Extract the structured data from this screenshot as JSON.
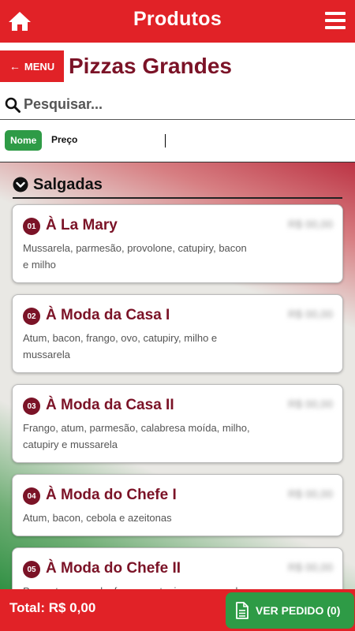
{
  "topbar": {
    "title": "Produtos"
  },
  "header": {
    "menu_label": "MENU",
    "page_title": "Pizzas Grandes"
  },
  "search": {
    "placeholder": "Pesquisar..."
  },
  "sort": {
    "nome": "Nome",
    "preco": "Preço"
  },
  "section": {
    "title": "Salgadas"
  },
  "products": [
    {
      "number": "01",
      "name": "À La Mary",
      "price": "R$ 00,00",
      "desc": "Mussarela, parmesão, provolone, catupiry, bacon e milho"
    },
    {
      "number": "02",
      "name": "À Moda da Casa I",
      "price": "R$ 00,00",
      "desc": "Atum, bacon, frango, ovo, catupiry, milho e mussarela"
    },
    {
      "number": "03",
      "name": "À Moda da Casa II",
      "price": "R$ 00,00",
      "desc": "Frango, atum, parmesão, calabresa moída, milho, catupiry e mussarela"
    },
    {
      "number": "04",
      "name": "À Moda do Chefe I",
      "price": "R$ 00,00",
      "desc": "Atum, bacon, cebola e azeitonas"
    },
    {
      "number": "05",
      "name": "À Moda do Chefe II",
      "price": "R$ 00,00",
      "desc": "Presunto, escarola, frango, catupiry e mussarela"
    }
  ],
  "footer": {
    "total": "Total: R$ 0,00",
    "ver_pedido": "VER PEDIDO (0)"
  },
  "colors": {
    "brand_red": "#e12227",
    "wine": "#7b1327",
    "green": "#2e9b46"
  }
}
